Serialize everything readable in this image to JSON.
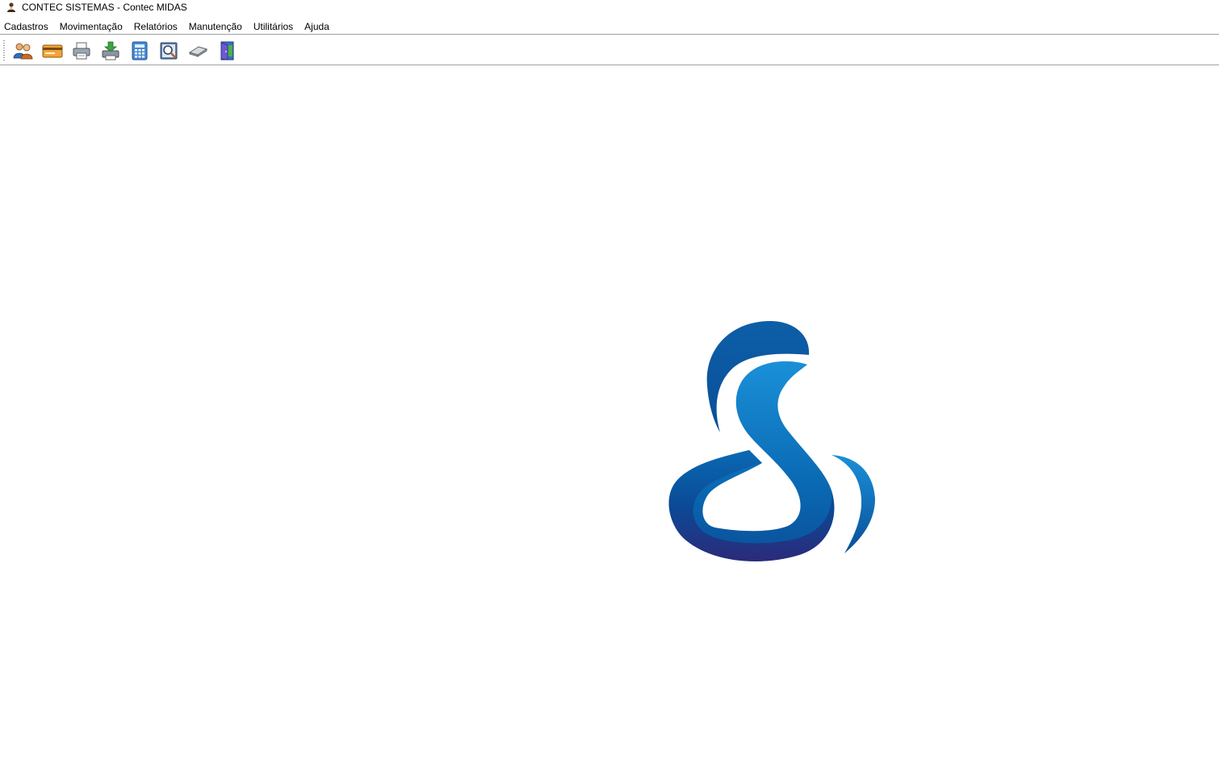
{
  "window": {
    "title": "CONTEC SISTEMAS - Contec MIDAS",
    "icon": "app-person-icon"
  },
  "menubar": {
    "items": [
      {
        "label": "Cadastros"
      },
      {
        "label": "Movimentação"
      },
      {
        "label": "Relatórios"
      },
      {
        "label": "Manutenção"
      },
      {
        "label": "Utilitários"
      },
      {
        "label": "Ajuda"
      }
    ]
  },
  "toolbar": {
    "buttons": [
      {
        "icon": "users-icon"
      },
      {
        "icon": "card-icon"
      },
      {
        "icon": "printer-icon"
      },
      {
        "icon": "download-printer-icon"
      },
      {
        "icon": "calculator-icon"
      },
      {
        "icon": "report-preview-icon"
      },
      {
        "icon": "eraser-icon"
      },
      {
        "icon": "exit-door-icon"
      }
    ]
  },
  "workspace": {
    "logo": "contec-s-logo",
    "colors": {
      "logo_light": "#1287cf",
      "logo_mid": "#0a5ea8",
      "logo_dark": "#2b2a7a"
    }
  }
}
